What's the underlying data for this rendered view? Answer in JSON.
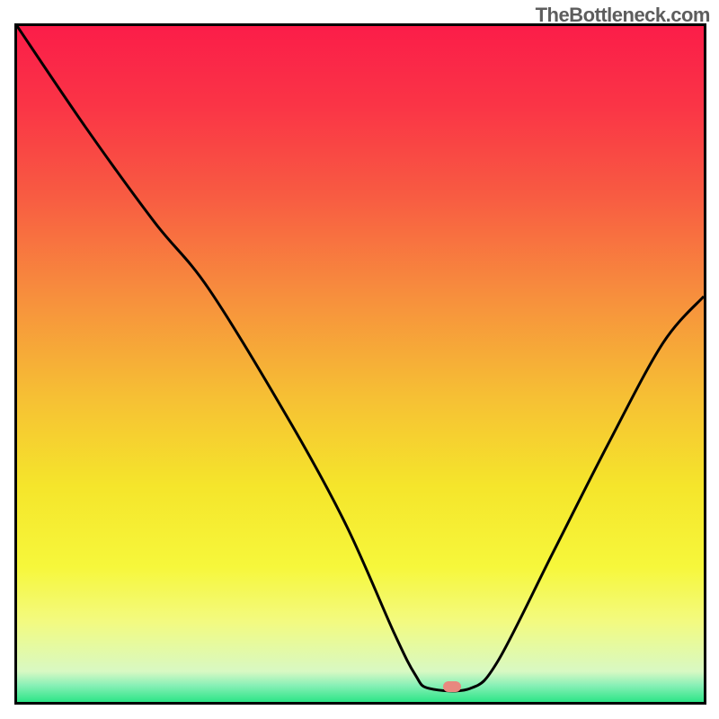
{
  "watermark": "TheBottleneck.com",
  "gradient_stops": [
    {
      "offset": 0.0,
      "color": "#fb1d49"
    },
    {
      "offset": 0.12,
      "color": "#fa3546"
    },
    {
      "offset": 0.25,
      "color": "#f85b42"
    },
    {
      "offset": 0.4,
      "color": "#f78f3d"
    },
    {
      "offset": 0.55,
      "color": "#f6c034"
    },
    {
      "offset": 0.68,
      "color": "#f5e52b"
    },
    {
      "offset": 0.8,
      "color": "#f6f73b"
    },
    {
      "offset": 0.88,
      "color": "#f3fa7f"
    },
    {
      "offset": 0.955,
      "color": "#d8f9c3"
    },
    {
      "offset": 0.975,
      "color": "#8af0b7"
    },
    {
      "offset": 1.0,
      "color": "#2de587"
    }
  ],
  "marker": {
    "x_pct": 63.3,
    "y_pct": 97.7,
    "color": "#e8887f"
  },
  "chart_data": {
    "type": "line",
    "title": "",
    "xlabel": "",
    "ylabel": "",
    "xlim": [
      0,
      100
    ],
    "ylim": [
      0,
      100
    ],
    "series": [
      {
        "name": "curve",
        "x": [
          0,
          10,
          20,
          28,
          40,
          48,
          55,
          58,
          60,
          66,
          70,
          78,
          86,
          94,
          100
        ],
        "y": [
          100,
          85,
          71,
          61,
          41,
          26,
          10,
          4,
          2,
          2,
          6,
          22,
          38,
          53,
          60
        ]
      }
    ],
    "marker_point": {
      "x": 63.3,
      "y": 2.3
    }
  }
}
